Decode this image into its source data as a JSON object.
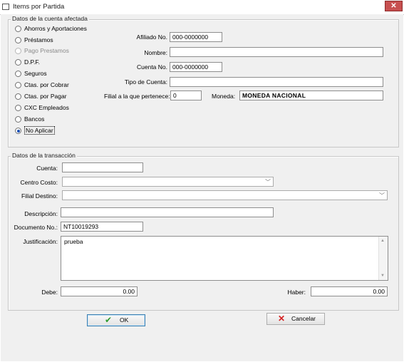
{
  "window": {
    "title": "Items por Partida",
    "close_glyph": "✕"
  },
  "cuenta_group": {
    "legend": "Datos de la cuenta afectada",
    "radios": [
      {
        "label": "Ahorros y Aportaciones",
        "checked": false,
        "disabled": false
      },
      {
        "label": "Préstamos",
        "checked": false,
        "disabled": false
      },
      {
        "label": "Pago Prestamos",
        "checked": false,
        "disabled": true
      },
      {
        "label": "D.P.F.",
        "checked": false,
        "disabled": false
      },
      {
        "label": "Seguros",
        "checked": false,
        "disabled": false
      },
      {
        "label": "Ctas. por Cobrar",
        "checked": false,
        "disabled": false
      },
      {
        "label": "Ctas. por Pagar",
        "checked": false,
        "disabled": false
      },
      {
        "label": "CXC Empleados",
        "checked": false,
        "disabled": false
      },
      {
        "label": "Bancos",
        "checked": false,
        "disabled": false
      },
      {
        "label": "No Aplicar",
        "checked": true,
        "disabled": false
      }
    ],
    "afiliado_label": "Afiliado No.",
    "afiliado_value": "000-0000000",
    "nombre_label": "Nombre:",
    "nombre_value": "",
    "cuenta_label": "Cuenta No.",
    "cuenta_value": "000-0000000",
    "tipo_label": "Tipo de Cuenta:",
    "tipo_value": "",
    "filial_label": "Filial a la que pertenece:",
    "filial_value": "0",
    "moneda_label": "Moneda:",
    "moneda_value": "MONEDA NACIONAL"
  },
  "transaccion_group": {
    "legend": "Datos de la transacción",
    "cuenta_label": "Cuenta:",
    "cuenta_value": "",
    "centro_label": "Centro Costo:",
    "centro_value": "",
    "filial_destino_label": "Filial Destino:",
    "filial_destino_value": "",
    "descripcion_label": "Descripción:",
    "descripcion_value": "",
    "documento_label": "Documento No.:",
    "documento_value": "NT10019293",
    "justificacion_label": "Justificación:",
    "justificacion_value": "prueba",
    "debe_label": "Debe:",
    "debe_value": "0.00",
    "haber_label": "Haber:",
    "haber_value": "0.00"
  },
  "buttons": {
    "ok_label": "OK",
    "ok_icon": "checkmark-icon",
    "cancel_label": "Cancelar",
    "cancel_icon": "cross-icon"
  },
  "colors": {
    "ok_check": "#2e9b2e",
    "cancel_x": "#d42020",
    "radio_selected": "#1a4fb5"
  }
}
